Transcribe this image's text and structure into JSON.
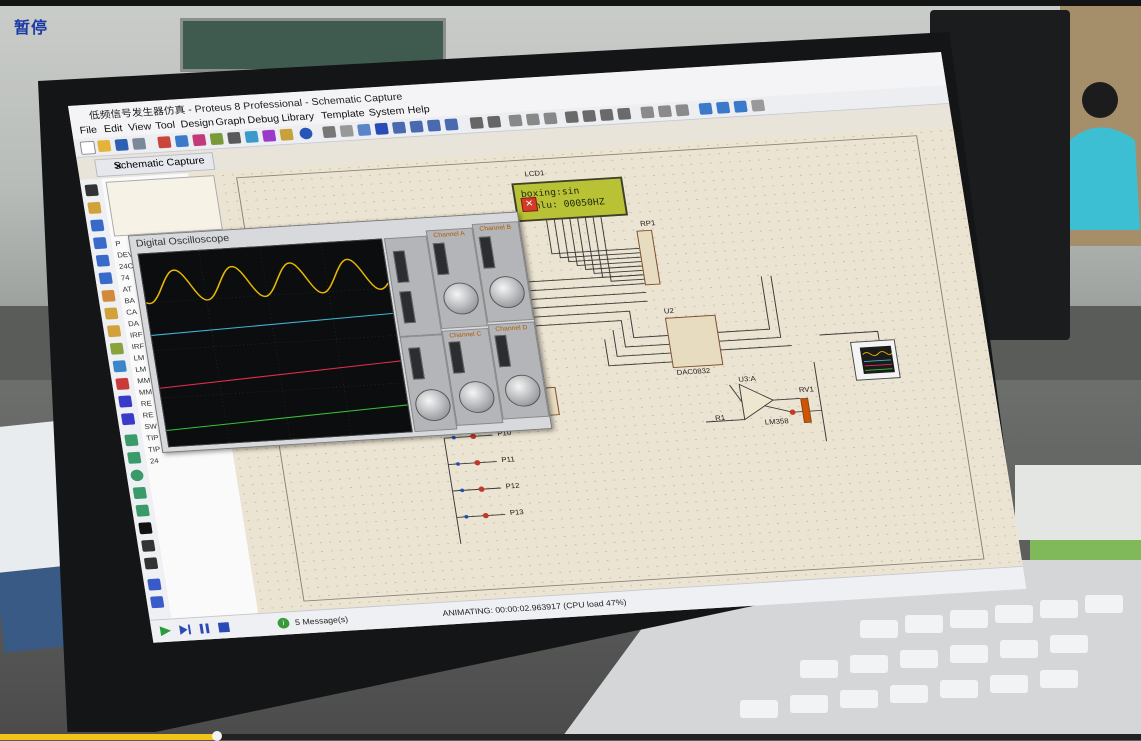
{
  "overlay": {
    "pause_label": "暂停"
  },
  "video_progress": {
    "fraction": 0.19
  },
  "app": {
    "title": "低频信号发生器仿真 - Proteus 8 Professional - Schematic Capture",
    "menu": [
      "File",
      "Edit",
      "View",
      "Tool",
      "Design",
      "Graph",
      "Debug",
      "Library",
      "Template",
      "System",
      "Help"
    ],
    "tab_label": "Schematic Capture",
    "device_list": [
      "P",
      "DEV",
      "24C",
      "74",
      "AT",
      "BA",
      "CA",
      "DA",
      "IRF",
      "IRF",
      "LM",
      "LM",
      "MM",
      "MM",
      "RE",
      "RE",
      "SW",
      "TIP",
      "TIP",
      "24"
    ],
    "status": {
      "messages": "5 Message(s)",
      "animating": "ANIMATING: 00:00:02.963917 (CPU load 47%)"
    }
  },
  "lcd": {
    "ref": "LCD1",
    "line1": "boxing:sin",
    "line2": "pinlu: 00050HZ"
  },
  "oscilloscope": {
    "title": "Digital Oscilloscope",
    "channels": [
      "Channel A",
      "Channel B",
      "Channel C",
      "Channel D"
    ],
    "trace_colors": {
      "a": "#e6b800",
      "b": "#3fb3d9",
      "c": "#e0304a",
      "d": "#39c03a"
    }
  },
  "schematic": {
    "labels": [
      "RP1",
      "U2",
      "U3:A",
      "RV1",
      "P10",
      "P11",
      "P12",
      "P13",
      "R1",
      "LM358",
      "DAC0832"
    ]
  },
  "colors": {
    "bezel": "#141516",
    "canvas": "#ece4d2",
    "wire": "#3a3a3a"
  }
}
